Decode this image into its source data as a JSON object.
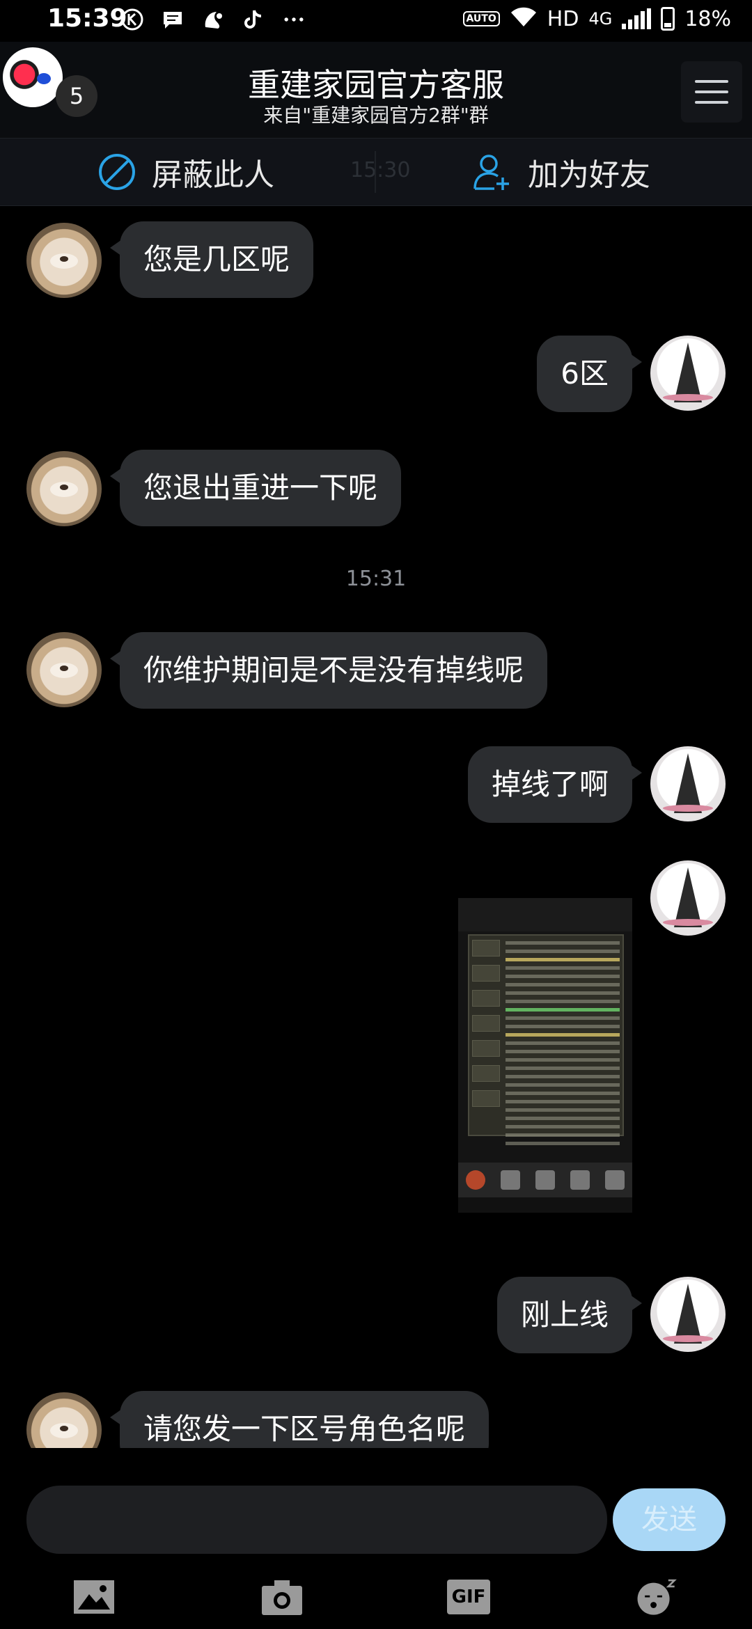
{
  "status_bar": {
    "time": "15:39",
    "auto_label": "AUTO",
    "network_label": "HD",
    "signal_label": "4G",
    "battery": "18%",
    "icons": [
      "k-icon",
      "message-icon",
      "uc-browser-icon",
      "tiktok-icon",
      "more-dots-icon",
      "wifi-icon",
      "signal-icon",
      "battery-icon"
    ]
  },
  "header": {
    "title": "重建家园官方客服",
    "subtitle": "来自\"重建家园官方2群\"群",
    "unread_count": "5"
  },
  "actions": {
    "block_label": "屏蔽此人",
    "add_friend_label": "加为好友",
    "ghost_time": "15:30"
  },
  "messages": [
    {
      "side": "left",
      "text": "您是几区呢"
    },
    {
      "side": "right",
      "text": "6区"
    },
    {
      "side": "left",
      "text": "您退出重进一下呢"
    },
    {
      "side": "left",
      "text": "你维护期间是不是没有掉线呢"
    },
    {
      "side": "right",
      "text": "掉线了啊"
    },
    {
      "side": "right",
      "type": "image"
    },
    {
      "side": "right",
      "text": "刚上线"
    },
    {
      "side": "left",
      "text": "请您发一下区号角色名呢"
    }
  ],
  "timestamps": [
    "15:31"
  ],
  "composer": {
    "placeholder": "",
    "send_label": "发送"
  },
  "toolbar": [
    "image-icon",
    "camera-icon",
    "gif-icon",
    "emoji-icon"
  ],
  "toolbar_gif_label": "GIF",
  "colors": {
    "background": "#000000",
    "bubble": "#2b2d30",
    "send_button": "#a9d7f6",
    "timestamp": "#8d9197",
    "accent_blue": "#2aa3e6"
  }
}
